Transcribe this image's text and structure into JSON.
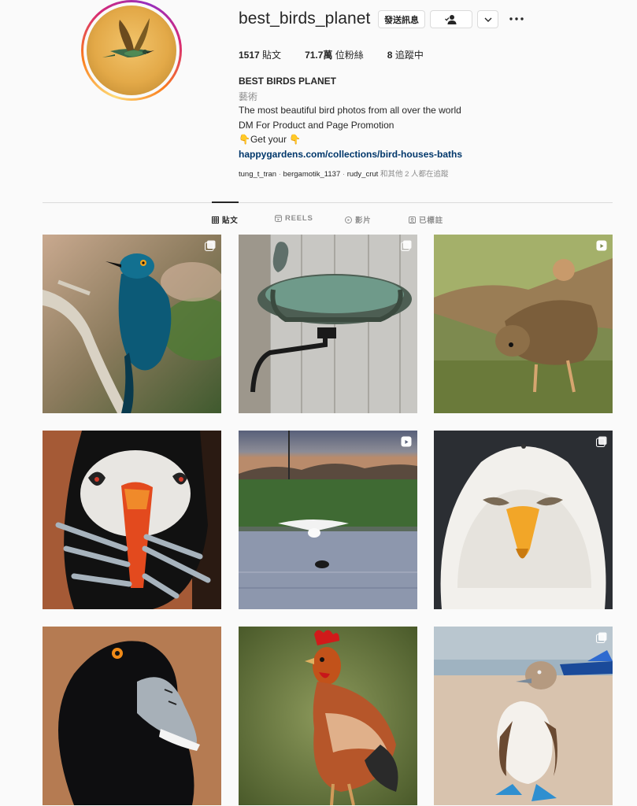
{
  "profile": {
    "username": "best_birds_planet",
    "message_button": "發送訊息",
    "more_icon": "ellipsis-icon"
  },
  "stats": {
    "posts_count": "1517",
    "posts_label": "貼文",
    "followers_count": "71.7萬",
    "followers_label": "位粉絲",
    "following_count": "8",
    "following_label": "追蹤中"
  },
  "bio": {
    "name": "BEST BIRDS PLANET",
    "category": "藝術",
    "line1": "The most beautiful bird photos from all over the world",
    "line2": "DM For Product and Page Promotion",
    "line3": "👇Get your 👇",
    "link": "happygardens.com/collections/bird-houses-baths"
  },
  "followed_by": {
    "user1": "tung_t_tran",
    "user2": "bergamotik_1137",
    "user3": "rudy_crut",
    "suffix": "和其他 2 人都在追蹤"
  },
  "tabs": [
    {
      "label": "貼文",
      "icon": "grid-icon",
      "active": true
    },
    {
      "label": "REELS",
      "icon": "reels-icon",
      "active": false
    },
    {
      "label": "影片",
      "icon": "video-icon",
      "active": false
    },
    {
      "label": "已標註",
      "icon": "tag-icon",
      "active": false
    }
  ],
  "posts": [
    {
      "subject": "blue starling on branch",
      "badge": "carousel"
    },
    {
      "subject": "bird bath with bird statue",
      "badge": "carousel"
    },
    {
      "subject": "grouse spreading wings",
      "badge": "reel"
    },
    {
      "subject": "puffin with fish",
      "badge": ""
    },
    {
      "subject": "swan landing on pond",
      "badge": "reel"
    },
    {
      "subject": "bald eagle face",
      "badge": "carousel"
    },
    {
      "subject": "ring-necked duck",
      "badge": ""
    },
    {
      "subject": "rooster",
      "badge": ""
    },
    {
      "subject": "blue-footed booby on beach",
      "badge": "carousel"
    }
  ],
  "colors": {
    "link": "#00376b",
    "secondary_text": "#8e8e8e",
    "border": "#dbdbdb"
  }
}
